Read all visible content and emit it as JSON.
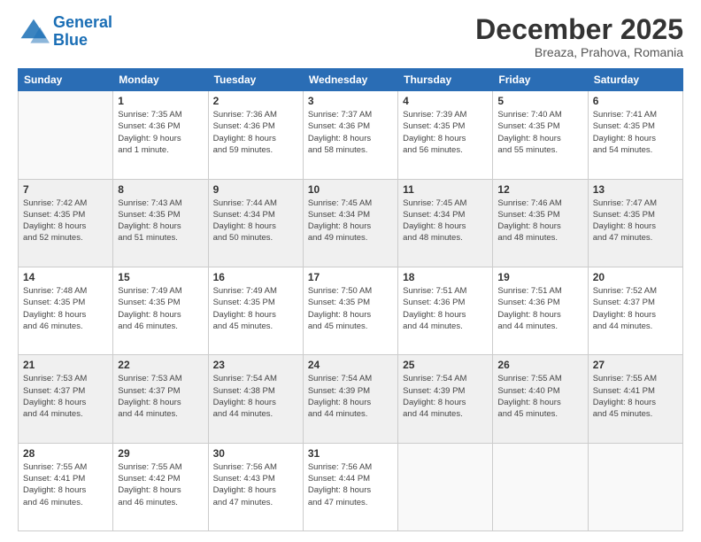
{
  "header": {
    "logo_line1": "General",
    "logo_line2": "Blue",
    "month": "December 2025",
    "location": "Breaza, Prahova, Romania"
  },
  "days_of_week": [
    "Sunday",
    "Monday",
    "Tuesday",
    "Wednesday",
    "Thursday",
    "Friday",
    "Saturday"
  ],
  "weeks": [
    [
      {
        "day": "",
        "info": ""
      },
      {
        "day": "1",
        "info": "Sunrise: 7:35 AM\nSunset: 4:36 PM\nDaylight: 9 hours\nand 1 minute."
      },
      {
        "day": "2",
        "info": "Sunrise: 7:36 AM\nSunset: 4:36 PM\nDaylight: 8 hours\nand 59 minutes."
      },
      {
        "day": "3",
        "info": "Sunrise: 7:37 AM\nSunset: 4:36 PM\nDaylight: 8 hours\nand 58 minutes."
      },
      {
        "day": "4",
        "info": "Sunrise: 7:39 AM\nSunset: 4:35 PM\nDaylight: 8 hours\nand 56 minutes."
      },
      {
        "day": "5",
        "info": "Sunrise: 7:40 AM\nSunset: 4:35 PM\nDaylight: 8 hours\nand 55 minutes."
      },
      {
        "day": "6",
        "info": "Sunrise: 7:41 AM\nSunset: 4:35 PM\nDaylight: 8 hours\nand 54 minutes."
      }
    ],
    [
      {
        "day": "7",
        "info": "Sunrise: 7:42 AM\nSunset: 4:35 PM\nDaylight: 8 hours\nand 52 minutes."
      },
      {
        "day": "8",
        "info": "Sunrise: 7:43 AM\nSunset: 4:35 PM\nDaylight: 8 hours\nand 51 minutes."
      },
      {
        "day": "9",
        "info": "Sunrise: 7:44 AM\nSunset: 4:34 PM\nDaylight: 8 hours\nand 50 minutes."
      },
      {
        "day": "10",
        "info": "Sunrise: 7:45 AM\nSunset: 4:34 PM\nDaylight: 8 hours\nand 49 minutes."
      },
      {
        "day": "11",
        "info": "Sunrise: 7:45 AM\nSunset: 4:34 PM\nDaylight: 8 hours\nand 48 minutes."
      },
      {
        "day": "12",
        "info": "Sunrise: 7:46 AM\nSunset: 4:35 PM\nDaylight: 8 hours\nand 48 minutes."
      },
      {
        "day": "13",
        "info": "Sunrise: 7:47 AM\nSunset: 4:35 PM\nDaylight: 8 hours\nand 47 minutes."
      }
    ],
    [
      {
        "day": "14",
        "info": "Sunrise: 7:48 AM\nSunset: 4:35 PM\nDaylight: 8 hours\nand 46 minutes."
      },
      {
        "day": "15",
        "info": "Sunrise: 7:49 AM\nSunset: 4:35 PM\nDaylight: 8 hours\nand 46 minutes."
      },
      {
        "day": "16",
        "info": "Sunrise: 7:49 AM\nSunset: 4:35 PM\nDaylight: 8 hours\nand 45 minutes."
      },
      {
        "day": "17",
        "info": "Sunrise: 7:50 AM\nSunset: 4:35 PM\nDaylight: 8 hours\nand 45 minutes."
      },
      {
        "day": "18",
        "info": "Sunrise: 7:51 AM\nSunset: 4:36 PM\nDaylight: 8 hours\nand 44 minutes."
      },
      {
        "day": "19",
        "info": "Sunrise: 7:51 AM\nSunset: 4:36 PM\nDaylight: 8 hours\nand 44 minutes."
      },
      {
        "day": "20",
        "info": "Sunrise: 7:52 AM\nSunset: 4:37 PM\nDaylight: 8 hours\nand 44 minutes."
      }
    ],
    [
      {
        "day": "21",
        "info": "Sunrise: 7:53 AM\nSunset: 4:37 PM\nDaylight: 8 hours\nand 44 minutes."
      },
      {
        "day": "22",
        "info": "Sunrise: 7:53 AM\nSunset: 4:37 PM\nDaylight: 8 hours\nand 44 minutes."
      },
      {
        "day": "23",
        "info": "Sunrise: 7:54 AM\nSunset: 4:38 PM\nDaylight: 8 hours\nand 44 minutes."
      },
      {
        "day": "24",
        "info": "Sunrise: 7:54 AM\nSunset: 4:39 PM\nDaylight: 8 hours\nand 44 minutes."
      },
      {
        "day": "25",
        "info": "Sunrise: 7:54 AM\nSunset: 4:39 PM\nDaylight: 8 hours\nand 44 minutes."
      },
      {
        "day": "26",
        "info": "Sunrise: 7:55 AM\nSunset: 4:40 PM\nDaylight: 8 hours\nand 45 minutes."
      },
      {
        "day": "27",
        "info": "Sunrise: 7:55 AM\nSunset: 4:41 PM\nDaylight: 8 hours\nand 45 minutes."
      }
    ],
    [
      {
        "day": "28",
        "info": "Sunrise: 7:55 AM\nSunset: 4:41 PM\nDaylight: 8 hours\nand 46 minutes."
      },
      {
        "day": "29",
        "info": "Sunrise: 7:55 AM\nSunset: 4:42 PM\nDaylight: 8 hours\nand 46 minutes."
      },
      {
        "day": "30",
        "info": "Sunrise: 7:56 AM\nSunset: 4:43 PM\nDaylight: 8 hours\nand 47 minutes."
      },
      {
        "day": "31",
        "info": "Sunrise: 7:56 AM\nSunset: 4:44 PM\nDaylight: 8 hours\nand 47 minutes."
      },
      {
        "day": "",
        "info": ""
      },
      {
        "day": "",
        "info": ""
      },
      {
        "day": "",
        "info": ""
      }
    ]
  ]
}
